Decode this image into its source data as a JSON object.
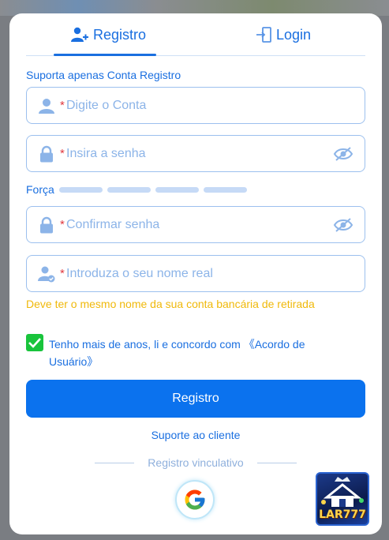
{
  "tabs": {
    "register": "Registro",
    "login": "Login",
    "active": "register"
  },
  "hint": "Suporta apenas Conta Registro",
  "fields": {
    "account_placeholder": "Digite o Conta",
    "password_placeholder": "Insira a senha",
    "confirm_placeholder": "Confirmar senha",
    "realname_placeholder": "Introduza o seu nome real",
    "required_mark": "*"
  },
  "strength": {
    "label": "Força",
    "level": 0,
    "segments": 4
  },
  "realname_warning": "Deve ter o mesmo nome da sua conta bancária de retirada",
  "agreement": {
    "checked": true,
    "text": "Tenho mais de anos, li e concordo com 《Acordo de Usuário》"
  },
  "register_button": "Registro",
  "support_link": "Suporte ao cliente",
  "divider_text": "Registro vinculativo",
  "app_logo_text": "LAR777",
  "icons": {
    "tab_register": "user-plus-icon",
    "tab_login": "login-door-icon",
    "account": "user-icon",
    "password": "lock-icon",
    "confirm": "lock-icon",
    "realname": "user-verified-icon",
    "eye": "eye-slash-icon",
    "google": "google-icon"
  },
  "colors": {
    "accent": "#1a6fe0",
    "button": "#0b72ee",
    "warning": "#f0b90b",
    "required": "#e0383e",
    "checkbox": "#19c43c"
  }
}
